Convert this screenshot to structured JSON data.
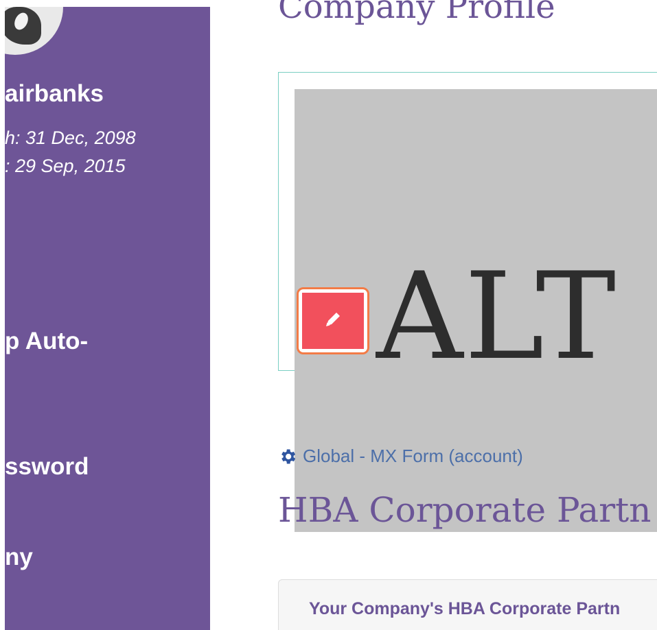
{
  "sidebar": {
    "user_name": "airbanks",
    "meta_line_1": "h: 31 Dec, 2098",
    "meta_line_2": ": 29 Sep, 2015",
    "items": [
      {
        "label": "p Auto-"
      },
      {
        "label": "ssword"
      },
      {
        "label": "ny"
      }
    ]
  },
  "main": {
    "page_title": "Company Profile",
    "image_alt": "ALT",
    "form_link": "Global - MX Form (account)",
    "section_title": "HBA Corporate Partn",
    "card_title": "Your Company's HBA Corporate Partn"
  },
  "icons": {
    "edit": "pencil-icon",
    "settings": "gear-icon"
  },
  "colors": {
    "sidebar_bg": "#6e5597",
    "heading": "#6b5597",
    "link": "#4c6fa9",
    "edit_button": "#f2505c",
    "edit_outline": "#f37b46",
    "frame": "#79cfc2",
    "placeholder": "#c4c4c4"
  }
}
